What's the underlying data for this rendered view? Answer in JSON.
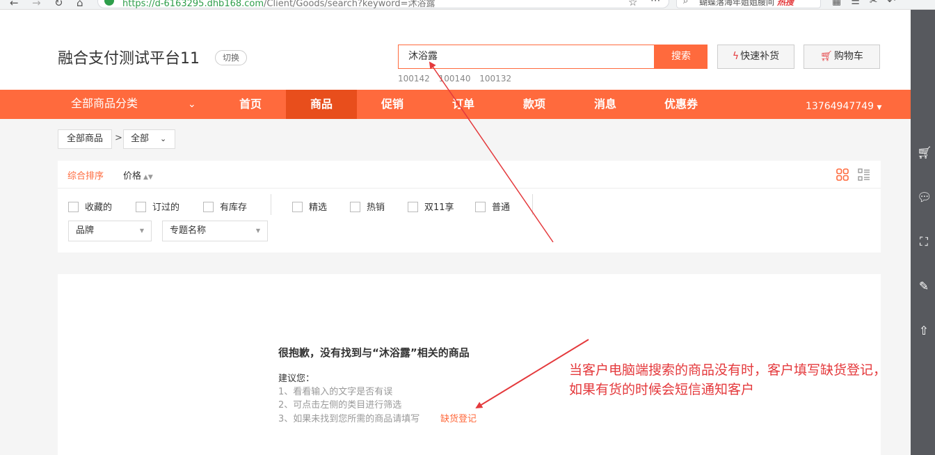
{
  "browser": {
    "url_host": "https://d-6163295.dhb168.com",
    "url_path": "/Client/Goods/search?keyword=沐浴露",
    "search_text": "蝴蝶落海年姐姐腰间",
    "search_hot": "热搜"
  },
  "header": {
    "brand": "融合支付测试平台11",
    "switch_label": "切换",
    "search_value": "沐浴露",
    "search_button": "搜索",
    "hot_words": [
      "100142",
      "100140",
      "100132"
    ],
    "quick_restock": "快速补货",
    "cart": "购物车"
  },
  "nav": {
    "all_categories": "全部商品分类",
    "items": [
      "首页",
      "商品",
      "促销",
      "订单",
      "款项",
      "消息",
      "优惠券"
    ],
    "active_index": 1,
    "user_phone": "13764947749"
  },
  "breadcrumb": {
    "all_goods": "全部商品",
    "separator": ">",
    "selected": "全部"
  },
  "filters": {
    "sort_default": "综合排序",
    "sort_price": "价格",
    "checkboxes": [
      "收藏的",
      "订过的",
      "有库存",
      "精选",
      "热销",
      "双11享",
      "普通"
    ],
    "brand_placeholder": "品牌",
    "topic_placeholder": "专题名称"
  },
  "result": {
    "title": "很抱歉，没有找到与“沐浴露”相关的商品",
    "suggest_heading": "建议您：",
    "suggestions": [
      "1、看看输入的文字是否有误",
      "2、可点击左侧的类目进行筛选",
      "3、如果未找到您所需的商品请填写"
    ],
    "register_link": "缺货登记"
  },
  "annotation": {
    "line1": "当客户电脑端搜索的商品没有时，客户填写缺货登记，",
    "line2": "如果有货的时候会短信通知客户"
  },
  "colors": {
    "accent": "#ff6a3d",
    "nav_active": "#e84e1c",
    "annotation_red": "#e4393c",
    "sidebar": "#57595e"
  }
}
